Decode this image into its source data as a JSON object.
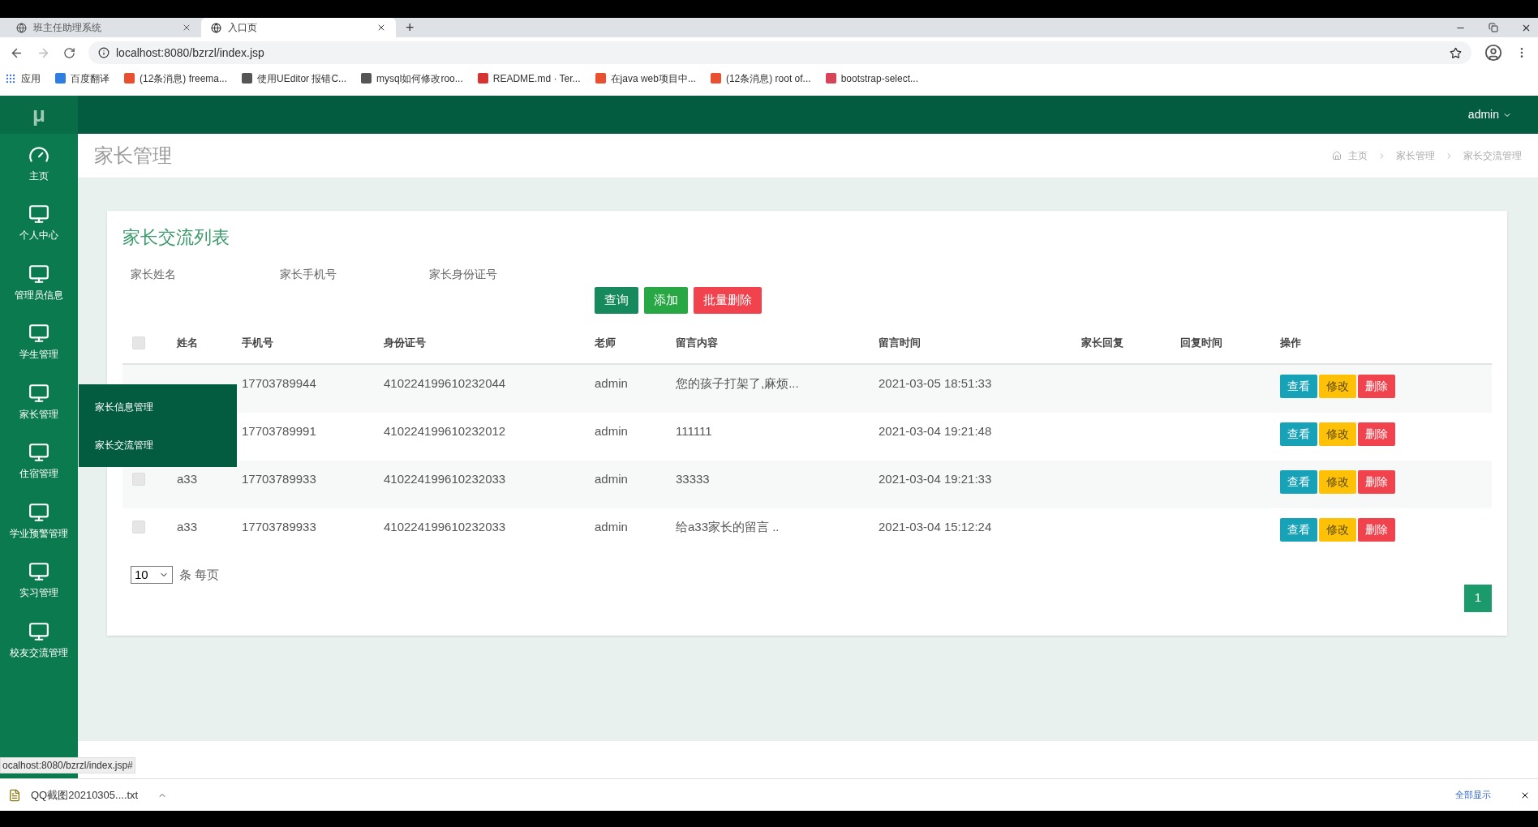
{
  "browser": {
    "tabs": [
      {
        "title": "班主任助理系统",
        "selected": false
      },
      {
        "title": "入口页",
        "selected": true
      }
    ],
    "new_tab": "+",
    "url": "localhost:8080/bzrzl/index.jsp",
    "bookmarks": [
      {
        "label": "应用",
        "color": "#3c6fd8"
      },
      {
        "label": "百度翻译",
        "color": "#2f7de1"
      },
      {
        "label": "(12条消息) freema...",
        "color": "#e8502f"
      },
      {
        "label": "使用UEditor 报错C...",
        "color": "#555555"
      },
      {
        "label": "mysql如何修改roo...",
        "color": "#555555"
      },
      {
        "label": "README.md · Ter...",
        "color": "#d63333"
      },
      {
        "label": "在java web项目中...",
        "color": "#e8502f"
      },
      {
        "label": "(12条消息) root of...",
        "color": "#e8502f"
      },
      {
        "label": "bootstrap-select...",
        "color": "#d9435a"
      }
    ]
  },
  "app": {
    "logo": "μ",
    "user": "admin"
  },
  "sidebar": {
    "items": [
      {
        "label": "主页"
      },
      {
        "label": "个人中心"
      },
      {
        "label": "管理员信息"
      },
      {
        "label": "学生管理"
      },
      {
        "label": "家长管理",
        "children": [
          {
            "label": "家长信息管理"
          },
          {
            "label": "家长交流管理"
          }
        ]
      },
      {
        "label": "住宿管理"
      },
      {
        "label": "学业预警管理"
      },
      {
        "label": "实习管理"
      },
      {
        "label": "校友交流管理"
      }
    ]
  },
  "page": {
    "title": "家长管理",
    "breadcrumb": [
      "主页",
      "家长管理",
      "家长交流管理"
    ]
  },
  "card": {
    "title": "家长交流列表",
    "search_fields": [
      {
        "placeholder": "家长姓名"
      },
      {
        "placeholder": "家长手机号"
      },
      {
        "placeholder": "家长身份证号"
      }
    ],
    "buttons": [
      {
        "label": "查询",
        "kind": "search"
      },
      {
        "label": "添加",
        "kind": "add"
      },
      {
        "label": "批量删除",
        "kind": "delete"
      }
    ],
    "table": {
      "header_checked": false,
      "columns": [
        "姓名",
        "手机号",
        "身份证号",
        "老师",
        "留言内容",
        "留言时间",
        "家长回复",
        "回复时间",
        "操作"
      ],
      "rows": [
        {
          "phone": "17703789944",
          "id_number": "410224199610232044",
          "teacher": "admin",
          "message": "您的孩子打架了,麻烦...",
          "time": "2021-03-05 18:51:33",
          "actions": [
            {
              "label": "查看",
              "kind": "view"
            },
            {
              "label": "修改",
              "kind": "edit"
            },
            {
              "label": "删除",
              "kind": "delete"
            }
          ]
        },
        {
          "phone": "17703789991",
          "id_number": "410224199610232012",
          "teacher": "admin",
          "message": "111111",
          "time": "2021-03-04 19:21:48",
          "actions": [
            {
              "label": "查看",
              "kind": "view"
            },
            {
              "label": "修改",
              "kind": "edit"
            },
            {
              "label": "删除",
              "kind": "delete"
            }
          ]
        },
        {
          "checked": false,
          "name": "a33",
          "phone": "17703789933",
          "id_number": "410224199610232033",
          "teacher": "admin",
          "message": "33333",
          "time": "2021-03-04 19:21:33",
          "actions": [
            {
              "label": "查看",
              "kind": "view"
            },
            {
              "label": "修改",
              "kind": "edit"
            },
            {
              "label": "删除",
              "kind": "delete"
            }
          ]
        },
        {
          "checked": false,
          "name": "a33",
          "phone": "17703789933",
          "id_number": "410224199610232033",
          "teacher": "admin",
          "message": "给a33家长的留言 ..",
          "time": "2021-03-04 15:12:24",
          "actions": [
            {
              "label": "查看",
              "kind": "view"
            },
            {
              "label": "修改",
              "kind": "edit"
            },
            {
              "label": "删除",
              "kind": "delete"
            }
          ]
        }
      ]
    },
    "page_size": "10",
    "page_size_label": "条 每页",
    "pages": [
      {
        "label": "1",
        "selected": true
      }
    ]
  },
  "status_url": "ocalhost:8080/bzrzl/index.jsp#",
  "downloads": {
    "file": "QQ截图20210305....txt",
    "show_all": "全部显示"
  }
}
